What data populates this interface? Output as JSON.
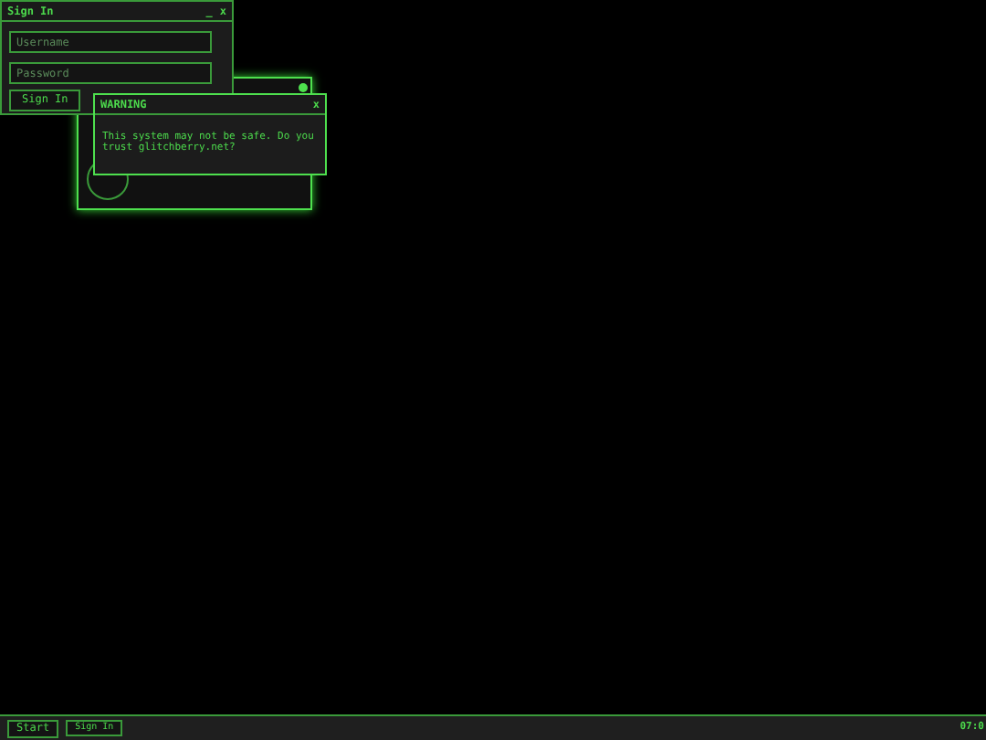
{
  "signin_window": {
    "title": "Sign In",
    "minimize": "_",
    "close": "x",
    "username": {
      "placeholder": "Username"
    },
    "password": {
      "placeholder": "Password"
    },
    "button": "Sign In"
  },
  "warning_window": {
    "title": "WARNING",
    "close": "x",
    "message": "This system may not be safe. Do you trust glitchberry.net?"
  },
  "taskbar": {
    "start": "Start",
    "tasks": [
      {
        "label": "Sign In"
      }
    ],
    "clock": "07:0"
  }
}
